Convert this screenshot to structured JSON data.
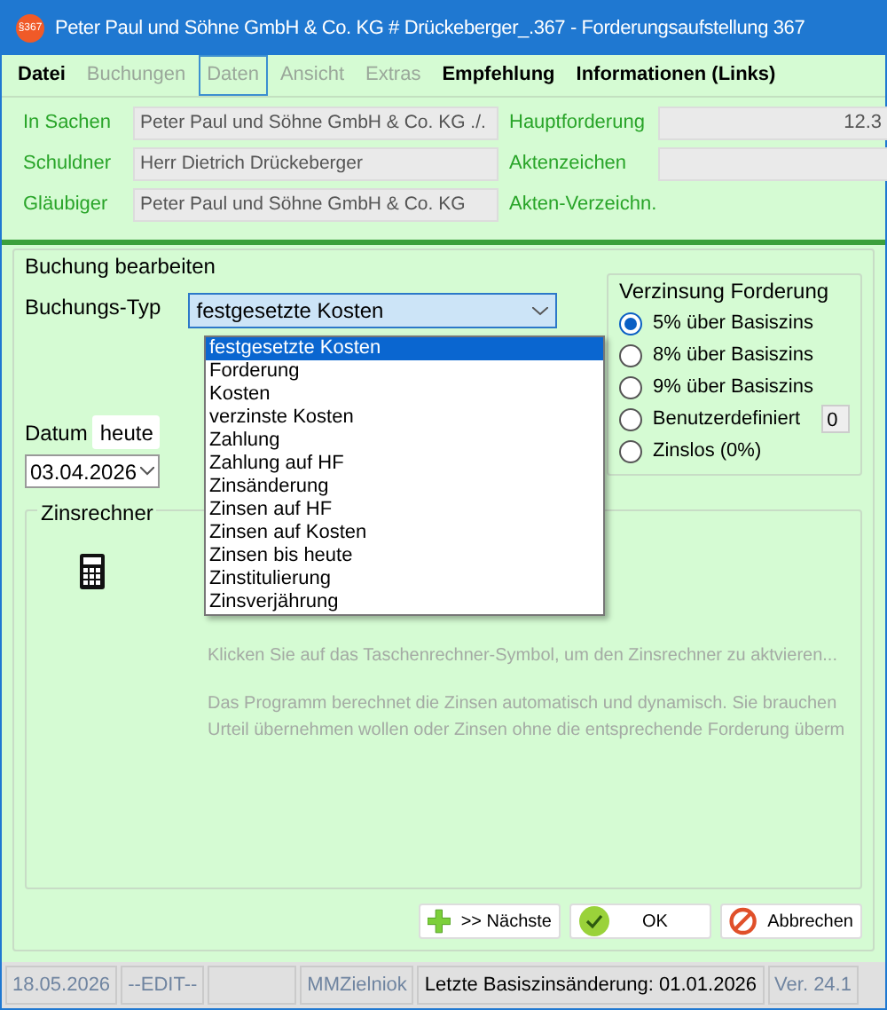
{
  "window": {
    "title": "Peter Paul und Söhne GmbH & Co. KG # Drückeberger_.367 - Forderungsaufstellung 367",
    "app_icon": "§367"
  },
  "menu": [
    {
      "label": "Datei",
      "disabled": false,
      "selected": false
    },
    {
      "label": "Buchungen",
      "disabled": true,
      "selected": false
    },
    {
      "label": "Daten",
      "disabled": true,
      "selected": true
    },
    {
      "label": "Ansicht",
      "disabled": true,
      "selected": false
    },
    {
      "label": "Extras",
      "disabled": true,
      "selected": false
    },
    {
      "label": "Empfehlung",
      "disabled": false,
      "selected": false
    },
    {
      "label": "Informationen (Links)",
      "disabled": false,
      "selected": false
    }
  ],
  "case_info": {
    "left": [
      {
        "label": "In Sachen",
        "value": "Peter Paul und Söhne GmbH & Co. KG ./."
      },
      {
        "label": "Schuldner",
        "value": "Herr Dietrich Drückeberger"
      },
      {
        "label": "Gläubiger",
        "value": "Peter Paul und Söhne GmbH & Co. KG"
      }
    ],
    "right": [
      {
        "label": "Hauptforderung",
        "kind": "field",
        "value": "12.3"
      },
      {
        "label": "Aktenzeichen",
        "kind": "field"
      },
      {
        "label": "Akten-Verzeichn.",
        "kind": "label"
      }
    ]
  },
  "booking": {
    "title": "Buchung bearbeiten",
    "type_label": "Buchungs-Typ",
    "type_value": "festgesetzte Kosten",
    "type_options": [
      {
        "label": "festgesetzte Kosten",
        "selected": true
      },
      {
        "label": "Forderung",
        "selected": false
      },
      {
        "label": "Kosten",
        "selected": false
      },
      {
        "label": "verzinste Kosten",
        "selected": false
      },
      {
        "label": "Zahlung",
        "selected": false
      },
      {
        "label": "Zahlung auf HF",
        "selected": false
      },
      {
        "label": "Zinsänderung",
        "selected": false
      },
      {
        "label": "Zinsen auf HF",
        "selected": false
      },
      {
        "label": "Zinsen auf Kosten",
        "selected": false
      },
      {
        "label": "Zinsen bis heute",
        "selected": false
      },
      {
        "label": "Zinstitulierung",
        "selected": false
      },
      {
        "label": "Zinsverjährung",
        "selected": false
      }
    ],
    "date_label": "Datum",
    "today_button": "heute",
    "date_value": "03.04.2026",
    "interest": {
      "title": "Verzinsung Forderung",
      "options": [
        {
          "label": "5% über Basiszins",
          "selected": true
        },
        {
          "label": "8% über Basiszins",
          "selected": false
        },
        {
          "label": "9% über Basiszins",
          "selected": false
        },
        {
          "label": "Benutzerdefiniert",
          "selected": false,
          "value": "0"
        },
        {
          "label": "Zinslos (0%)",
          "selected": false
        }
      ]
    },
    "calculator": {
      "title": "Zinsrechner",
      "hint": "Klicken Sie auf das Taschenrechner-Symbol, um den Zinsrechner zu aktvieren...",
      "info_lines": [
        "Das Programm berechnet die Zinsen automatisch und dynamisch. Sie brauchen",
        "Urteil übernehmen wollen oder Zinsen ohne die entsprechende Forderung überm"
      ]
    }
  },
  "buttons": [
    {
      "kind": "next",
      "label": ">> Nächste"
    },
    {
      "kind": "ok",
      "label": "OK"
    },
    {
      "kind": "cancel",
      "label": "Abbrechen"
    }
  ],
  "status_bar": [
    {
      "text": "18.05.2026",
      "disabled": true
    },
    {
      "text": "--EDIT--",
      "disabled": true
    },
    {
      "kind": "blank"
    },
    {
      "text": "MMZielniok",
      "disabled": true
    },
    {
      "text": "Letzte Basiszinsänderung: 01.01.2026",
      "disabled": false
    },
    {
      "text": "Ver. 24.1",
      "disabled": true
    }
  ]
}
